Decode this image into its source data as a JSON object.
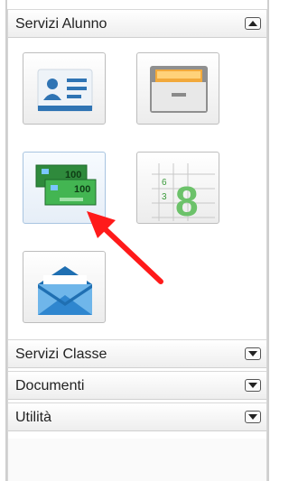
{
  "sections": {
    "servizi_alunno": {
      "label": "Servizi Alunno",
      "state": "expanded"
    },
    "servizi_classe": {
      "label": "Servizi Classe",
      "state": "collapsed"
    },
    "documenti": {
      "label": "Documenti",
      "state": "collapsed"
    },
    "utilita": {
      "label": "Utilità",
      "state": "collapsed"
    }
  },
  "tiles": [
    {
      "icon": "id-card-icon"
    },
    {
      "icon": "file-drawer-icon"
    },
    {
      "icon": "banknotes-icon",
      "text_1": "100",
      "text_2": "100",
      "selected": true
    },
    {
      "icon": "calendar-grid-icon",
      "small_1": "6",
      "small_2": "3",
      "big": "8"
    },
    {
      "icon": "envelope-icon"
    }
  ],
  "annotation": {
    "icon": "red-arrow-icon",
    "color": "#ff1a1a"
  },
  "colors": {
    "accent_blue": "#3b76b5",
    "money_green": "#3aa34a",
    "calendar_green": "#6cc26a",
    "folder_orange": "#f2a93b"
  }
}
